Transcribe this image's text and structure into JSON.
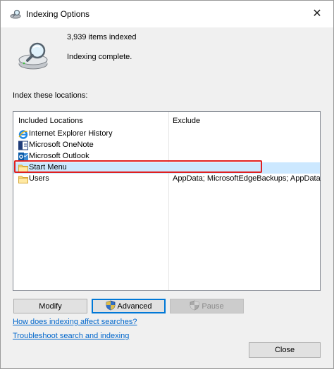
{
  "window": {
    "title": "Indexing Options",
    "close_glyph": "✕"
  },
  "status": {
    "items_indexed": "3,939 items indexed",
    "state": "Indexing complete."
  },
  "locations": {
    "section_label": "Index these locations:",
    "columns": {
      "included": "Included Locations",
      "exclude": "Exclude"
    },
    "rows": [
      {
        "name": "Internet Explorer History",
        "exclude": "",
        "icon": "internet-explorer-icon"
      },
      {
        "name": "Microsoft OneNote",
        "exclude": "",
        "icon": "onenote-icon"
      },
      {
        "name": "Microsoft Outlook",
        "exclude": "",
        "icon": "outlook-icon"
      },
      {
        "name": "Start Menu",
        "exclude": "",
        "icon": "folder-icon",
        "selected": true
      },
      {
        "name": "Users",
        "exclude": "AppData; MicrosoftEdgeBackups; AppData",
        "icon": "folder-icon"
      }
    ]
  },
  "buttons": {
    "modify": "Modify",
    "advanced": "Advanced",
    "pause": "Pause",
    "close": "Close"
  },
  "links": {
    "how_affects": "How does indexing affect searches?",
    "troubleshoot": "Troubleshoot search and indexing"
  },
  "colors": {
    "selection": "#cce8ff",
    "highlight_border": "#e02020",
    "link": "#0066cc",
    "focus": "#0078d7"
  }
}
